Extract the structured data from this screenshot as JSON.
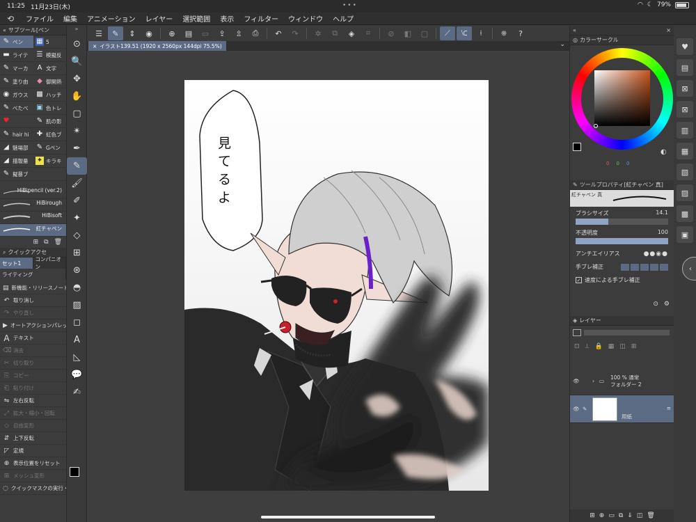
{
  "status": {
    "time": "11:25",
    "date": "11月23日(木)",
    "battery": "79%"
  },
  "menu": [
    "ファイル",
    "編集",
    "アニメーション",
    "レイヤー",
    "選択範囲",
    "表示",
    "フィルター",
    "ウィンドウ",
    "ヘルプ"
  ],
  "subtool_panel": {
    "title": "サブツール[ペン",
    "items": [
      {
        "icon": "✎",
        "label": "ペン"
      },
      {
        "icon": "▦",
        "label": "5"
      },
      {
        "icon": "▬",
        "label": "ライテ"
      },
      {
        "icon": "☰",
        "label": "模擬反"
      },
      {
        "icon": "✎",
        "label": "マーカ"
      },
      {
        "icon": "A",
        "label": "文字"
      },
      {
        "icon": "✎",
        "label": "塗り由"
      },
      {
        "icon": "◆",
        "label": "御開熱"
      },
      {
        "icon": "◉",
        "label": "ガウス"
      },
      {
        "icon": "▩",
        "label": "ハッチ"
      },
      {
        "icon": "✎",
        "label": "べたべ"
      },
      {
        "icon": "▣",
        "label": "色トレ"
      },
      {
        "icon": "♥",
        "label": ""
      },
      {
        "icon": "✎",
        "label": "肌の影"
      },
      {
        "icon": "✎",
        "label": "hair hi"
      },
      {
        "icon": "✚",
        "label": "虹色ブ"
      },
      {
        "icon": "◢",
        "label": "魅場部"
      },
      {
        "icon": "✎",
        "label": "Gペン"
      },
      {
        "icon": "◢",
        "label": "描報量"
      },
      {
        "icon": "✦",
        "label": "キラキ"
      },
      {
        "icon": "✎",
        "label": "擬暴ブ"
      },
      {
        "icon": "",
        "label": ""
      }
    ]
  },
  "brushes": [
    "HiBipencil (ver.2)",
    "HiBirough",
    "HiBisoft",
    "紅チャペン"
  ],
  "quick_access": {
    "title": "クイックアクセ",
    "tabs": [
      "セット1",
      "コンパニオン"
    ],
    "tab2": "ライティング",
    "rows": [
      {
        "icon": "▤",
        "label": "新機能・リリースノート!",
        "enabled": true
      },
      {
        "icon": "↶",
        "label": "取り消し",
        "enabled": true
      },
      {
        "icon": "↷",
        "label": "やり直し",
        "enabled": false
      },
      {
        "icon": "▶",
        "label": "オートアクションパレッ",
        "enabled": true
      },
      {
        "icon": "A",
        "label": "テキスト",
        "enabled": true
      },
      {
        "icon": "⌫",
        "label": "消去",
        "enabled": false
      },
      {
        "icon": "✂",
        "label": "切り取り",
        "enabled": false
      },
      {
        "icon": "⎘",
        "label": "コピー",
        "enabled": false
      },
      {
        "icon": "⎗",
        "label": "貼り付け",
        "enabled": false
      },
      {
        "icon": "⇋",
        "label": "左右反転",
        "enabled": true
      },
      {
        "icon": "⤢",
        "label": "拡大・縮小・回転",
        "enabled": false
      },
      {
        "icon": "◇",
        "label": "自由変形",
        "enabled": false
      },
      {
        "icon": "⇵",
        "label": "上下反転",
        "enabled": true
      },
      {
        "icon": "◸",
        "label": "定規",
        "enabled": true
      },
      {
        "icon": "⊕",
        "label": "表示位置をリセット",
        "enabled": true
      },
      {
        "icon": "⊞",
        "label": "メッシュ変形",
        "enabled": false
      },
      {
        "icon": "◌",
        "label": "クイックマスクの実行・",
        "enabled": true
      }
    ]
  },
  "tools": [
    "⊙",
    "🔍",
    "✥",
    "✋",
    "▢",
    "✴",
    "✒",
    "✎",
    "🖌",
    "✐",
    "✦",
    "◇",
    "⊞",
    "⊛",
    "◓",
    "▨",
    "◻",
    "A",
    "◺",
    "💬",
    "✍"
  ],
  "document_tab": "イラスト139.51 (1920 x 2560px 144dpi 75.5%)",
  "speech_bubble": "見てるよ",
  "color_circle": {
    "title": "カラーサークル",
    "hue_color": "#c8541c",
    "values": [
      "0",
      "0",
      "0"
    ]
  },
  "tool_property": {
    "title": "ツールプロパティ[紅チャペン 真]",
    "preset": "紅チャペン 真",
    "brush_size_label": "ブラシサイズ",
    "brush_size_value": "14.1",
    "brush_size_fraction": 0.35,
    "opacity_label": "不透明度",
    "opacity_value": "100",
    "opacity_fraction": 1.0,
    "antialias_label": "アンチエイリアス",
    "stabilization_label": "手ブレ補正",
    "speed_label": "速度による手ブレ補正"
  },
  "layer_panel": {
    "title": "レイヤー",
    "layers": [
      {
        "name": "100 % 通常\nフォルダー 2",
        "line1": "100 % 通常",
        "line2": "フォルダー 2",
        "type": "folder"
      },
      {
        "name": "用紙",
        "line1": "",
        "line2": "用紙",
        "type": "paper"
      }
    ]
  }
}
